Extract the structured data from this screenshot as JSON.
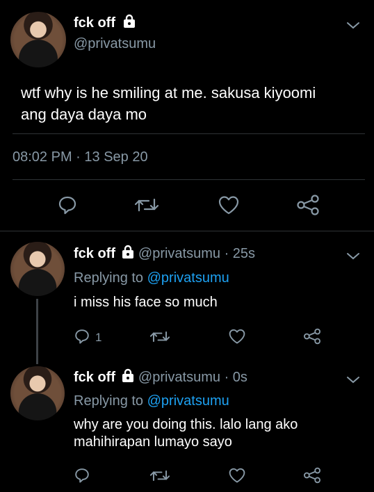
{
  "main": {
    "name": "fck off",
    "handle": "@privatsumu",
    "text_line1": "wtf why is he smiling at me. sakusa kiyoomi",
    "text_line2": "ang daya daya mo",
    "time": "08:02 PM",
    "dot": "·",
    "date": "13 Sep 20",
    "icons": [
      "reply-icon",
      "retweet-icon",
      "like-icon",
      "share-icon"
    ]
  },
  "replies": [
    {
      "name": "fck off",
      "handle_time": "@privatsumu · 25s",
      "replying_prefix": "Replying to",
      "replying_to": "@privatsumu",
      "text_lines": [
        "i miss his face so much"
      ],
      "reply_count": "1"
    },
    {
      "name": "fck off",
      "handle_time": "@privatsumu · 0s",
      "replying_prefix": "Replying to",
      "replying_to": "@privatsumu",
      "text_lines": [
        "why are you doing this. lalo lang ako",
        "mahihirapan lumayo sayo"
      ],
      "reply_count": ""
    }
  ],
  "colors": {
    "background": "#000000",
    "muted": "#8899a6",
    "link": "#1da1f2",
    "divider": "#2f3336"
  }
}
